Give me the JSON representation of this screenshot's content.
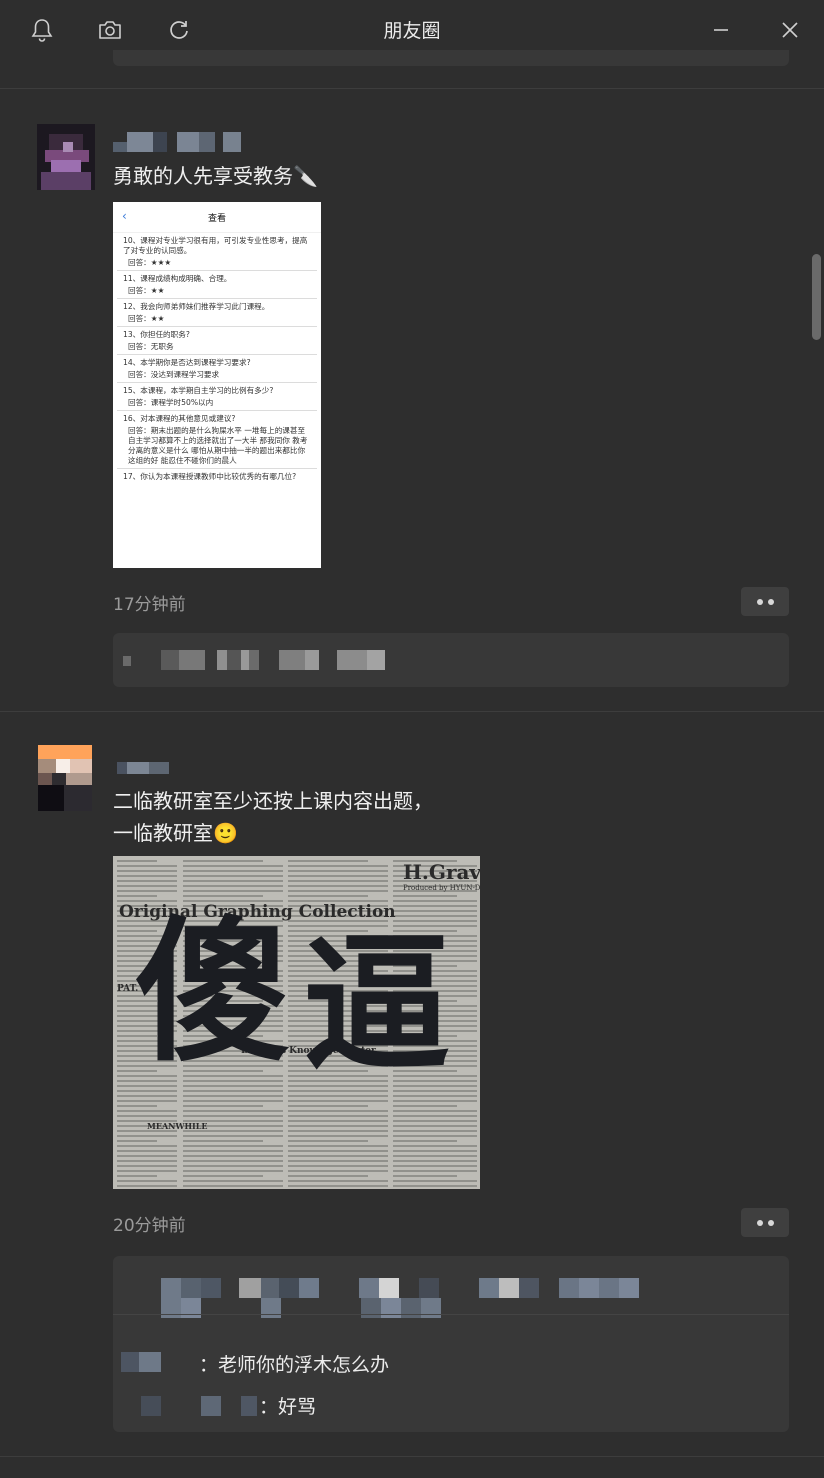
{
  "window": {
    "title": "朋友圈",
    "icons": [
      "bell-icon",
      "camera-icon",
      "refresh-icon",
      "minimize-icon",
      "close-icon"
    ]
  },
  "posts": [
    {
      "text_lines": [
        "勇敢的人先享受教务🔪"
      ],
      "image": {
        "header": "查看",
        "back": "‹",
        "items": [
          {
            "q": "10、课程对专业学习很有用，可引发专业性思考，提高了对专业的认同感。",
            "a": "回答：★★★"
          },
          {
            "q": "11、课程成绩构成明确、合理。",
            "a": "回答：★★"
          },
          {
            "q": "12、我会向师弟师妹们推荐学习此门课程。",
            "a": "回答：★★"
          },
          {
            "q": "13、你担任的职务?",
            "a": "回答：无职务"
          },
          {
            "q": "14、本学期你是否达到课程学习要求?",
            "a": "回答：没达到课程学习要求"
          },
          {
            "q": "15、本课程，本学期自主学习的比例有多少?",
            "a": "回答：课程学时50%以内"
          },
          {
            "q": "16、对本课程的其他意见或建议?",
            "a": "回答：期末出题的是什么狗屎水平 一堆每上的课甚至自主学习都算不上的选择就出了一大半 那我同你 教考分离的意义是什么 哪怕从期中抽一半的题出来都比你这组的好 能忍住不碰你们的晨人"
          },
          {
            "q": "17、你认为本课程授课教师中比较优秀的有哪几位?",
            "a": ""
          }
        ]
      },
      "time": "17分钟前"
    },
    {
      "text_lines": [
        "二临教研室至少还按上课内容出题，",
        "一临教研室🙂"
      ],
      "image": {
        "headline": "Original Graphing Collection",
        "brand": "H.Gravur",
        "brand_sub": "Produced by HYUN-DAI",
        "sub": "Business Knowlage Center",
        "footer": "MEANWHILE",
        "left_label": "PAT.",
        "calligraphy": [
          "傻",
          "逼"
        ]
      },
      "time": "20分钟前",
      "comments": [
        {
          "text": "：老师你的浮木怎么办"
        },
        {
          "text": "：好骂"
        }
      ]
    }
  ],
  "colors": {
    "background": "#2e2e2e",
    "comment_box": "#383838",
    "timestamp": "#9a9a9a",
    "text": "#f0f0f0"
  }
}
